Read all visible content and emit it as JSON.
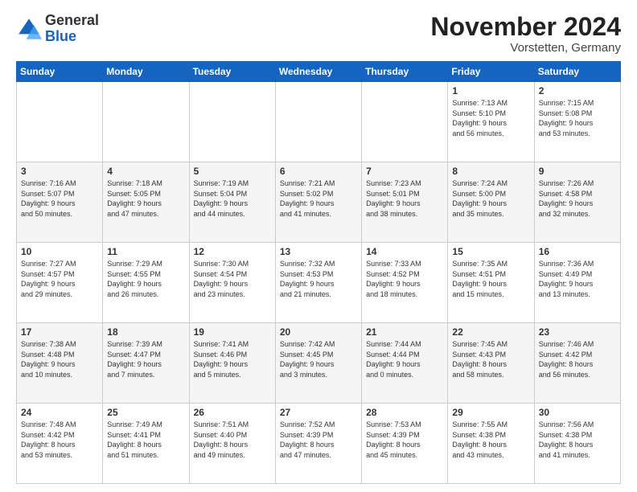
{
  "header": {
    "logo": {
      "general": "General",
      "blue": "Blue"
    },
    "title": "November 2024",
    "location": "Vorstetten, Germany"
  },
  "calendar": {
    "weekdays": [
      "Sunday",
      "Monday",
      "Tuesday",
      "Wednesday",
      "Thursday",
      "Friday",
      "Saturday"
    ],
    "weeks": [
      [
        {
          "day": "",
          "info": ""
        },
        {
          "day": "",
          "info": ""
        },
        {
          "day": "",
          "info": ""
        },
        {
          "day": "",
          "info": ""
        },
        {
          "day": "",
          "info": ""
        },
        {
          "day": "1",
          "info": "Sunrise: 7:13 AM\nSunset: 5:10 PM\nDaylight: 9 hours\nand 56 minutes."
        },
        {
          "day": "2",
          "info": "Sunrise: 7:15 AM\nSunset: 5:08 PM\nDaylight: 9 hours\nand 53 minutes."
        }
      ],
      [
        {
          "day": "3",
          "info": "Sunrise: 7:16 AM\nSunset: 5:07 PM\nDaylight: 9 hours\nand 50 minutes."
        },
        {
          "day": "4",
          "info": "Sunrise: 7:18 AM\nSunset: 5:05 PM\nDaylight: 9 hours\nand 47 minutes."
        },
        {
          "day": "5",
          "info": "Sunrise: 7:19 AM\nSunset: 5:04 PM\nDaylight: 9 hours\nand 44 minutes."
        },
        {
          "day": "6",
          "info": "Sunrise: 7:21 AM\nSunset: 5:02 PM\nDaylight: 9 hours\nand 41 minutes."
        },
        {
          "day": "7",
          "info": "Sunrise: 7:23 AM\nSunset: 5:01 PM\nDaylight: 9 hours\nand 38 minutes."
        },
        {
          "day": "8",
          "info": "Sunrise: 7:24 AM\nSunset: 5:00 PM\nDaylight: 9 hours\nand 35 minutes."
        },
        {
          "day": "9",
          "info": "Sunrise: 7:26 AM\nSunset: 4:58 PM\nDaylight: 9 hours\nand 32 minutes."
        }
      ],
      [
        {
          "day": "10",
          "info": "Sunrise: 7:27 AM\nSunset: 4:57 PM\nDaylight: 9 hours\nand 29 minutes."
        },
        {
          "day": "11",
          "info": "Sunrise: 7:29 AM\nSunset: 4:55 PM\nDaylight: 9 hours\nand 26 minutes."
        },
        {
          "day": "12",
          "info": "Sunrise: 7:30 AM\nSunset: 4:54 PM\nDaylight: 9 hours\nand 23 minutes."
        },
        {
          "day": "13",
          "info": "Sunrise: 7:32 AM\nSunset: 4:53 PM\nDaylight: 9 hours\nand 21 minutes."
        },
        {
          "day": "14",
          "info": "Sunrise: 7:33 AM\nSunset: 4:52 PM\nDaylight: 9 hours\nand 18 minutes."
        },
        {
          "day": "15",
          "info": "Sunrise: 7:35 AM\nSunset: 4:51 PM\nDaylight: 9 hours\nand 15 minutes."
        },
        {
          "day": "16",
          "info": "Sunrise: 7:36 AM\nSunset: 4:49 PM\nDaylight: 9 hours\nand 13 minutes."
        }
      ],
      [
        {
          "day": "17",
          "info": "Sunrise: 7:38 AM\nSunset: 4:48 PM\nDaylight: 9 hours\nand 10 minutes."
        },
        {
          "day": "18",
          "info": "Sunrise: 7:39 AM\nSunset: 4:47 PM\nDaylight: 9 hours\nand 7 minutes."
        },
        {
          "day": "19",
          "info": "Sunrise: 7:41 AM\nSunset: 4:46 PM\nDaylight: 9 hours\nand 5 minutes."
        },
        {
          "day": "20",
          "info": "Sunrise: 7:42 AM\nSunset: 4:45 PM\nDaylight: 9 hours\nand 3 minutes."
        },
        {
          "day": "21",
          "info": "Sunrise: 7:44 AM\nSunset: 4:44 PM\nDaylight: 9 hours\nand 0 minutes."
        },
        {
          "day": "22",
          "info": "Sunrise: 7:45 AM\nSunset: 4:43 PM\nDaylight: 8 hours\nand 58 minutes."
        },
        {
          "day": "23",
          "info": "Sunrise: 7:46 AM\nSunset: 4:42 PM\nDaylight: 8 hours\nand 56 minutes."
        }
      ],
      [
        {
          "day": "24",
          "info": "Sunrise: 7:48 AM\nSunset: 4:42 PM\nDaylight: 8 hours\nand 53 minutes."
        },
        {
          "day": "25",
          "info": "Sunrise: 7:49 AM\nSunset: 4:41 PM\nDaylight: 8 hours\nand 51 minutes."
        },
        {
          "day": "26",
          "info": "Sunrise: 7:51 AM\nSunset: 4:40 PM\nDaylight: 8 hours\nand 49 minutes."
        },
        {
          "day": "27",
          "info": "Sunrise: 7:52 AM\nSunset: 4:39 PM\nDaylight: 8 hours\nand 47 minutes."
        },
        {
          "day": "28",
          "info": "Sunrise: 7:53 AM\nSunset: 4:39 PM\nDaylight: 8 hours\nand 45 minutes."
        },
        {
          "day": "29",
          "info": "Sunrise: 7:55 AM\nSunset: 4:38 PM\nDaylight: 8 hours\nand 43 minutes."
        },
        {
          "day": "30",
          "info": "Sunrise: 7:56 AM\nSunset: 4:38 PM\nDaylight: 8 hours\nand 41 minutes."
        }
      ]
    ]
  }
}
